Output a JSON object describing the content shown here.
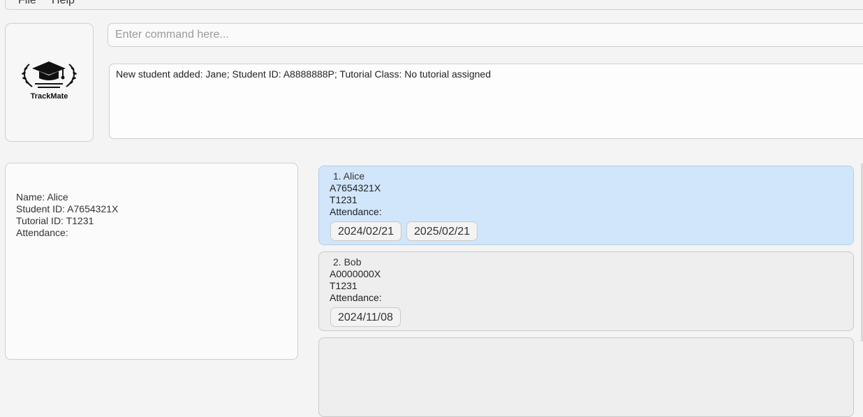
{
  "menu": {
    "file": "File",
    "help": "Help"
  },
  "logo": {
    "text": "TrackMate"
  },
  "command": {
    "placeholder": "Enter command here...",
    "value": ""
  },
  "result": {
    "text": "New student added: Jane; Student ID: A8888888P; Tutorial Class: No tutorial assigned"
  },
  "detail": {
    "name": "Name:  Alice",
    "student_id": "Student ID:  A7654321X",
    "tutorial_id": "Tutorial ID:  T1231",
    "attendance": "Attendance:"
  },
  "students": [
    {
      "name": "1. Alice",
      "id": "A7654321X",
      "tutorial": "T1231",
      "attendance_label": "Attendance:",
      "dates": [
        "2024/02/21",
        "2025/02/21"
      ],
      "selected": true
    },
    {
      "name": "2. Bob",
      "id": "A0000000X",
      "tutorial": "T1231",
      "attendance_label": "Attendance:",
      "dates": [
        "2024/11/08"
      ],
      "selected": false
    }
  ],
  "colors": {
    "selected": "#d1e6fb",
    "card": "#eeeeee",
    "background": "#f4f4f4"
  }
}
